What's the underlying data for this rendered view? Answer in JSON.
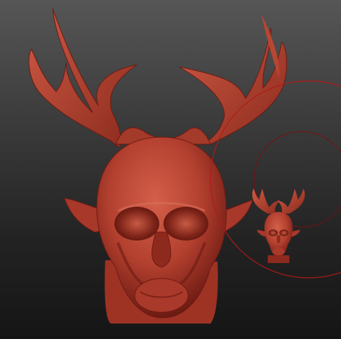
{
  "app": {
    "canvas_background": [
      "#565656",
      "#151515"
    ]
  },
  "model": {
    "name_icon": "deer-skull-sculpt",
    "clay_color": "#b3402f",
    "clay_shadow": "#6d1a12",
    "clay_highlight": "#d86a55"
  },
  "brush_cursor": {
    "icon": "brush-radius-circles",
    "outer_ring_color": "#b01a1a",
    "inner_ring_color": "#7a1010"
  },
  "thumbnail": {
    "icon": "navigation-preview-model"
  }
}
